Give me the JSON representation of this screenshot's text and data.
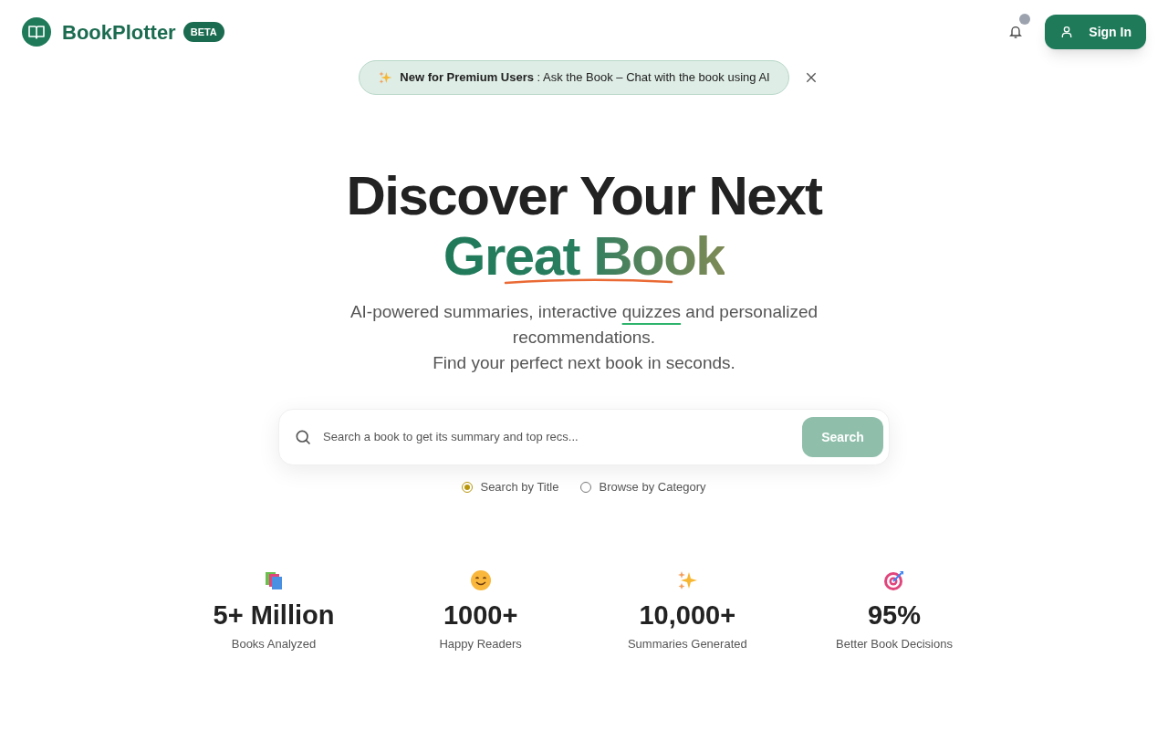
{
  "header": {
    "brand": "BookPlotter",
    "badge": "BETA",
    "notification_dot": true,
    "sign_in": "Sign In"
  },
  "announcement": {
    "bold": "New for Premium Users",
    "text": " : Ask the Book – Chat with the book using AI"
  },
  "hero": {
    "line1": "Discover Your Next",
    "line2": "Great Book",
    "subtitle_before": "AI-powered summaries, interactive ",
    "subtitle_underlined": "quizzes",
    "subtitle_after": " and personalized recommendations.",
    "subtitle_line2": "Find your perfect next book in seconds."
  },
  "search": {
    "placeholder": "Search a book to get its summary and top recs...",
    "button": "Search",
    "button_disabled": true
  },
  "search_modes": [
    {
      "label": "Search by Title",
      "selected": true
    },
    {
      "label": "Browse by Category",
      "selected": false
    }
  ],
  "stats": [
    {
      "kind": "books",
      "value": "5+ Million",
      "label": "Books Analyzed"
    },
    {
      "kind": "smile",
      "value": "1000+",
      "label": "Happy Readers"
    },
    {
      "kind": "sparkles",
      "value": "10,000+",
      "label": "Summaries Generated"
    },
    {
      "kind": "target",
      "value": "95%",
      "label": "Better Book Decisions"
    }
  ]
}
